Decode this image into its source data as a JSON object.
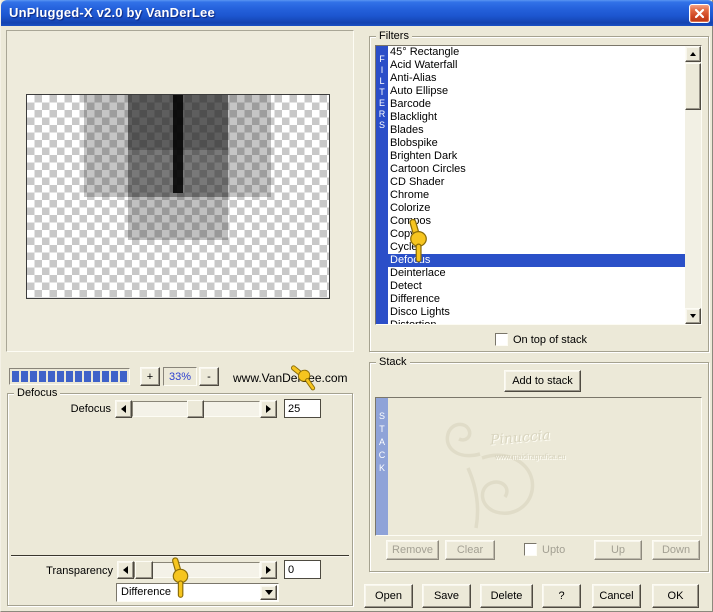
{
  "window": {
    "title": "UnPlugged-X v2.0 by VanDerLee"
  },
  "icons": {
    "close": "close-x",
    "scroll_up": "triangle-up",
    "scroll_down": "triangle-down",
    "slider_left": "triangle-left",
    "slider_right": "triangle-right",
    "combo_arrow": "triangle-down",
    "hand": "pointing-hand-cursor"
  },
  "preview": {
    "zoom_in_label": "+",
    "zoom_level": "33%",
    "zoom_out_label": "-",
    "website": "www.VanDerLee.com",
    "progress_segments": 13
  },
  "defocus_group": {
    "label": "Defocus",
    "slider_label": "Defocus",
    "value": "25"
  },
  "transparency": {
    "label": "Transparency",
    "value": "0"
  },
  "blend_mode": {
    "value": "Difference"
  },
  "filters": {
    "label": "Filters",
    "strip": "FILTERS",
    "selected_index": 16,
    "items": [
      "45° Rectangle",
      "Acid Waterfall",
      "Anti-Alias",
      "Auto Ellipse",
      "Barcode",
      "Blacklight",
      "Blades",
      "Blobspike",
      "Brighten Dark",
      "Cartoon Circles",
      "CD Shader",
      "Chrome",
      "Colorize",
      "Compos",
      "Copys",
      "Cycle",
      "Defocus",
      "Deinterlace",
      "Detect",
      "Difference",
      "Disco Lights",
      "Distortion"
    ],
    "on_top_label": "On top of stack"
  },
  "stack": {
    "label": "Stack",
    "strip": "STACK",
    "add_button": "Add to stack",
    "watermark_name": "Pinuccia",
    "watermark_url": "www.maidiragrafica.eu",
    "upto_label": "Upto",
    "buttons": [
      {
        "name": "remove",
        "label": "Remove"
      },
      {
        "name": "clear",
        "label": "Clear"
      },
      {
        "name": "up",
        "label": "Up"
      },
      {
        "name": "down",
        "label": "Down"
      }
    ]
  },
  "footer": {
    "buttons": [
      {
        "name": "open",
        "label": "Open"
      },
      {
        "name": "save",
        "label": "Save"
      },
      {
        "name": "delete",
        "label": "Delete"
      },
      {
        "name": "help",
        "label": "?"
      },
      {
        "name": "cancel",
        "label": "Cancel"
      },
      {
        "name": "ok",
        "label": "OK"
      }
    ]
  }
}
